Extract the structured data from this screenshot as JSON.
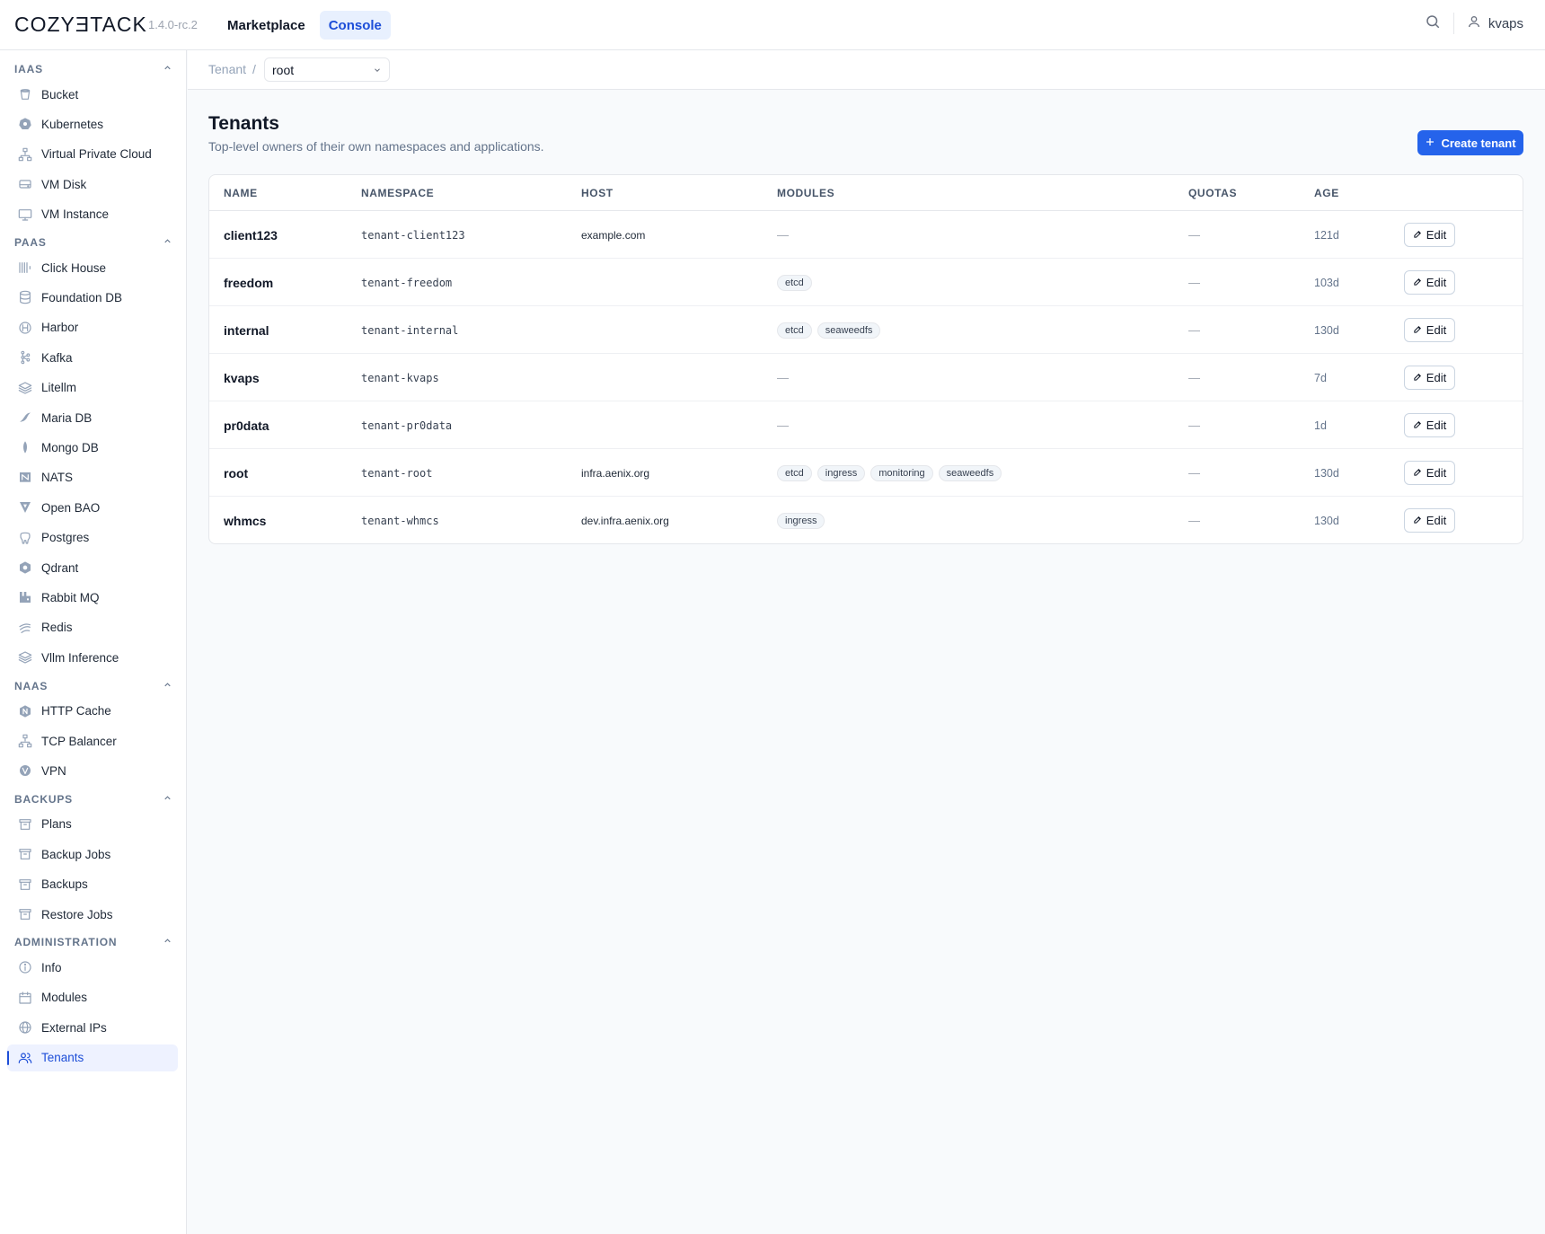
{
  "header": {
    "logo": "COZYƎTACK",
    "version": "1.4.0-rc.2",
    "nav": [
      {
        "label": "Marketplace"
      },
      {
        "label": "Console"
      }
    ],
    "user": "kvaps"
  },
  "sidebar": {
    "sections": [
      {
        "title": "IAAS",
        "items": [
          {
            "label": "Bucket",
            "icon": "bucket-icon"
          },
          {
            "label": "Kubernetes",
            "icon": "kubernetes-icon"
          },
          {
            "label": "Virtual Private Cloud",
            "icon": "network-icon"
          },
          {
            "label": "VM Disk",
            "icon": "disk-icon"
          },
          {
            "label": "VM Instance",
            "icon": "monitor-icon"
          }
        ]
      },
      {
        "title": "PAAS",
        "items": [
          {
            "label": "Click House",
            "icon": "clickhouse-icon"
          },
          {
            "label": "Foundation DB",
            "icon": "database-icon"
          },
          {
            "label": "Harbor",
            "icon": "harbor-icon"
          },
          {
            "label": "Kafka",
            "icon": "kafka-icon"
          },
          {
            "label": "Litellm",
            "icon": "layers-icon"
          },
          {
            "label": "Maria DB",
            "icon": "mariadb-icon"
          },
          {
            "label": "Mongo DB",
            "icon": "leaf-icon"
          },
          {
            "label": "NATS",
            "icon": "nats-icon"
          },
          {
            "label": "Open BAO",
            "icon": "openbao-icon"
          },
          {
            "label": "Postgres",
            "icon": "elephant-icon"
          },
          {
            "label": "Qdrant",
            "icon": "qdrant-icon"
          },
          {
            "label": "Rabbit MQ",
            "icon": "rabbitmq-icon"
          },
          {
            "label": "Redis",
            "icon": "redis-icon"
          },
          {
            "label": "Vllm Inference",
            "icon": "layers-icon"
          }
        ]
      },
      {
        "title": "NAAS",
        "items": [
          {
            "label": "HTTP Cache",
            "icon": "nginx-icon"
          },
          {
            "label": "TCP Balancer",
            "icon": "network-icon"
          },
          {
            "label": "VPN",
            "icon": "vpn-icon"
          }
        ]
      },
      {
        "title": "BACKUPS",
        "items": [
          {
            "label": "Plans",
            "icon": "archive-icon"
          },
          {
            "label": "Backup Jobs",
            "icon": "archive-icon"
          },
          {
            "label": "Backups",
            "icon": "archive-icon"
          },
          {
            "label": "Restore Jobs",
            "icon": "archive-icon"
          }
        ]
      },
      {
        "title": "ADMINISTRATION",
        "items": [
          {
            "label": "Info",
            "icon": "info-icon"
          },
          {
            "label": "Modules",
            "icon": "calendar-icon"
          },
          {
            "label": "External IPs",
            "icon": "globe-icon"
          },
          {
            "label": "Tenants",
            "icon": "users-icon",
            "active": true
          }
        ]
      }
    ]
  },
  "breadcrumb": {
    "label": "Tenant",
    "separator": "/",
    "selected": "root"
  },
  "page": {
    "title": "Tenants",
    "subtitle": "Top-level owners of their own namespaces and applications.",
    "create_label": "Create tenant"
  },
  "table": {
    "columns": [
      "NAME",
      "NAMESPACE",
      "HOST",
      "MODULES",
      "QUOTAS",
      "AGE"
    ],
    "edit_label": "Edit",
    "empty": "—",
    "rows": [
      {
        "name": "client123",
        "namespace": "tenant-client123",
        "host": "example.com",
        "modules": [],
        "quotas": "—",
        "age": "121d"
      },
      {
        "name": "freedom",
        "namespace": "tenant-freedom",
        "host": "",
        "modules": [
          "etcd"
        ],
        "quotas": "—",
        "age": "103d"
      },
      {
        "name": "internal",
        "namespace": "tenant-internal",
        "host": "",
        "modules": [
          "etcd",
          "seaweedfs"
        ],
        "quotas": "—",
        "age": "130d"
      },
      {
        "name": "kvaps",
        "namespace": "tenant-kvaps",
        "host": "",
        "modules": [],
        "quotas": "—",
        "age": "7d"
      },
      {
        "name": "pr0data",
        "namespace": "tenant-pr0data",
        "host": "",
        "modules": [],
        "quotas": "—",
        "age": "1d"
      },
      {
        "name": "root",
        "namespace": "tenant-root",
        "host": "infra.aenix.org",
        "modules": [
          "etcd",
          "ingress",
          "monitoring",
          "seaweedfs"
        ],
        "quotas": "—",
        "age": "130d"
      },
      {
        "name": "whmcs",
        "namespace": "tenant-whmcs",
        "host": "dev.infra.aenix.org",
        "modules": [
          "ingress"
        ],
        "quotas": "—",
        "age": "130d"
      }
    ]
  },
  "colors": {
    "accent": "#2563eb",
    "active_nav_bg": "#e8f0fe",
    "icon": "#94a3b8"
  }
}
